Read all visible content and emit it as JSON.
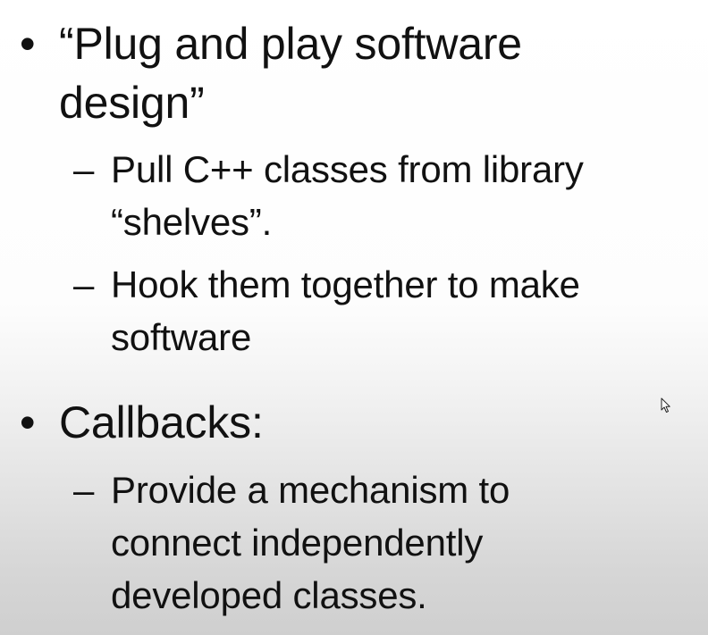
{
  "slide": {
    "bullets": [
      {
        "marker": "•",
        "text": "“Plug and play software design”",
        "subitems": [
          {
            "marker": "–",
            "text": "Pull C++ classes from library “shelves”."
          },
          {
            "marker": "–",
            "text": "Hook them together to make software"
          }
        ]
      },
      {
        "marker": "•",
        "text": "Callbacks:",
        "subitems": [
          {
            "marker": "–",
            "text": "Provide a mechanism to connect independently developed classes."
          }
        ]
      }
    ]
  },
  "icons": {
    "cursor": "mouse-pointer-icon"
  }
}
